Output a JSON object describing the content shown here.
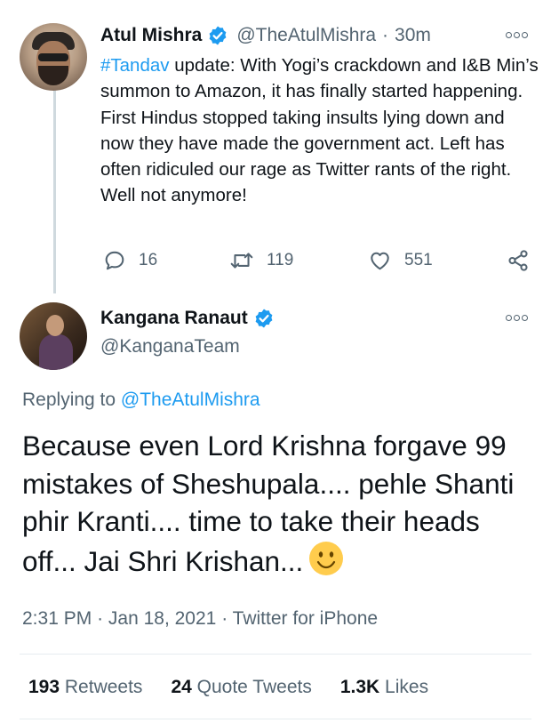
{
  "parent_tweet": {
    "author_name": "Atul Mishra",
    "handle": "@TheAtulMishra",
    "separator": "·",
    "time_ago": "30m",
    "avatar_icon": "user-avatar",
    "text": {
      "hashtag": "#Tandav",
      "body": " update: With Yogi’s crackdown and I&B Min’s summon to Amazon, it has finally started happening. First Hindus stopped taking insults lying down and now they have made the government act. Left has often ridiculed our rage as Twitter rants of the right. Well not anymore!"
    },
    "actions": {
      "reply_count": "16",
      "retweet_count": "119",
      "like_count": "551"
    }
  },
  "main_tweet": {
    "author_name": "Kangana Ranaut",
    "handle": "@KanganaTeam",
    "avatar_icon": "user-avatar",
    "replying_prefix": "Replying to ",
    "replying_to": "@TheAtulMishra",
    "text": "Because even Lord Krishna forgave 99 mistakes of Sheshupala.... pehle Shanti phir Kranti.... time to take their heads off... Jai Shri Krishan...",
    "time": "2:31 PM",
    "dot": "·",
    "date": "Jan 18, 2021",
    "source": "Twitter for iPhone",
    "stats": {
      "retweets_count": "193",
      "retweets_label": "Retweets",
      "quotes_count": "24",
      "quotes_label": "Quote Tweets",
      "likes_count": "1.3K",
      "likes_label": "Likes"
    }
  },
  "colors": {
    "accent": "#1d9bf0",
    "secondary_text": "#536471",
    "primary_text": "#0f1419",
    "divider": "#e6ecf0"
  }
}
